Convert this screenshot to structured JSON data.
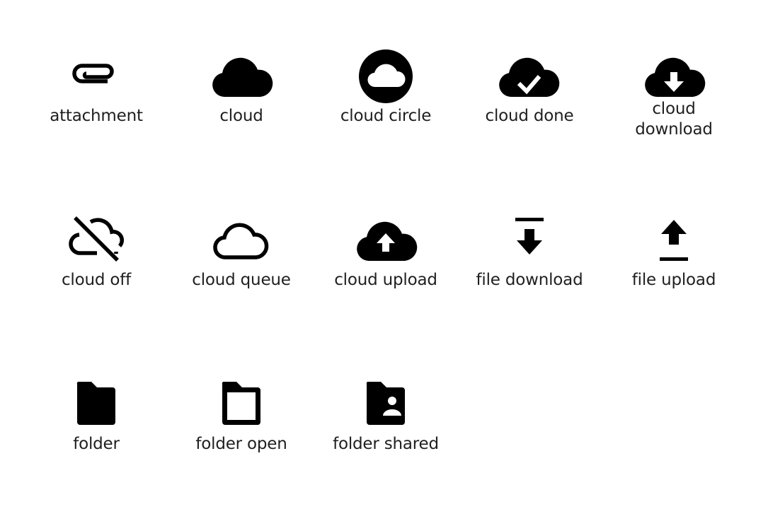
{
  "icons": [
    {
      "name": "attachment",
      "label": "attachment"
    },
    {
      "name": "cloud",
      "label": "cloud"
    },
    {
      "name": "cloud-circle",
      "label": "cloud circle"
    },
    {
      "name": "cloud-done",
      "label": "cloud done"
    },
    {
      "name": "cloud-download",
      "label_line1": "cloud",
      "label_line2": "download"
    },
    {
      "name": "cloud-off",
      "label": "cloud off"
    },
    {
      "name": "cloud-queue",
      "label": "cloud queue"
    },
    {
      "name": "cloud-upload",
      "label": "cloud upload"
    },
    {
      "name": "file-download",
      "label": "file download"
    },
    {
      "name": "file-upload",
      "label": "file upload"
    },
    {
      "name": "folder",
      "label": "folder"
    },
    {
      "name": "folder-open",
      "label": "folder open"
    },
    {
      "name": "folder-shared",
      "label": "folder shared"
    }
  ],
  "colors": {
    "icon": "#000000",
    "text": "#1f1f1f",
    "background": "#ffffff"
  }
}
